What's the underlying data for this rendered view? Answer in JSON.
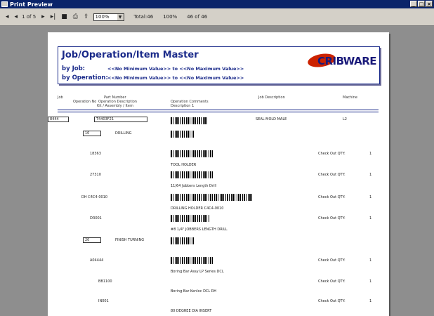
{
  "window": {
    "title": "Print Preview",
    "buttons": [
      "_",
      "□",
      "×"
    ]
  },
  "toolbar": {
    "page": "1 of 5",
    "zoom": "100%",
    "total": "Total:46",
    "percent": "100%",
    "count": "46 of 46",
    "icons": [
      "first-page-icon",
      "prev-page-icon",
      "next-page-icon",
      "last-page-icon",
      "stop-icon",
      "print-icon",
      "export-icon"
    ]
  },
  "report": {
    "title": "Job/Operation/Item Master",
    "by_job_label": "by Job:",
    "by_job_value": "<<No Minimum Value>> to <<No Maximum Value>>",
    "by_op_label": "by Operation:",
    "by_op_value": "<<No Minimum Value>> to <<No Maximum Value>>",
    "logo": "CRIBWARE",
    "headers": {
      "job": "Job",
      "op": "Operation No",
      "part": "Part Number",
      "opdesc": "Operation Description",
      "kit": "Kit / Assembly / Item",
      "opcomments": "Operation Comments",
      "desc1": "Description 1",
      "jobdesc": "Job Description",
      "machine": "Machine"
    },
    "job_row": {
      "job": "8444",
      "part": "T4403F21",
      "jobdesc": "SEAL MOLD MALE",
      "machine": "L2"
    },
    "op1": {
      "no": "10",
      "desc": "DRILLING"
    },
    "op2": {
      "no": "20",
      "desc": "FINISH TURNING"
    },
    "check_label": "Check Out QTY:",
    "items": [
      {
        "part": "18363",
        "desc": "TOOL HOLDER",
        "qty": "1"
      },
      {
        "part": "27310",
        "desc": "11/64 Jobbers Length Drill",
        "qty": "1"
      },
      {
        "part": "DH C4C4-0010",
        "desc": "DRILLING HOLDER C4C4-0010",
        "qty": "1"
      },
      {
        "part": "DR001",
        "desc": "#8 1/4\" JOBBERS LENGTH DRILL",
        "qty": "1"
      },
      {
        "part": "A04444",
        "desc": "Boring Bar Assy LP Series DCL",
        "qty": "1"
      },
      {
        "part": "BB1100",
        "desc": "Boring Bar Kenloc DCL RH",
        "qty": "1"
      },
      {
        "part": "IN001",
        "desc": "80 DEGREE DIA INSERT",
        "qty": "1"
      }
    ]
  }
}
